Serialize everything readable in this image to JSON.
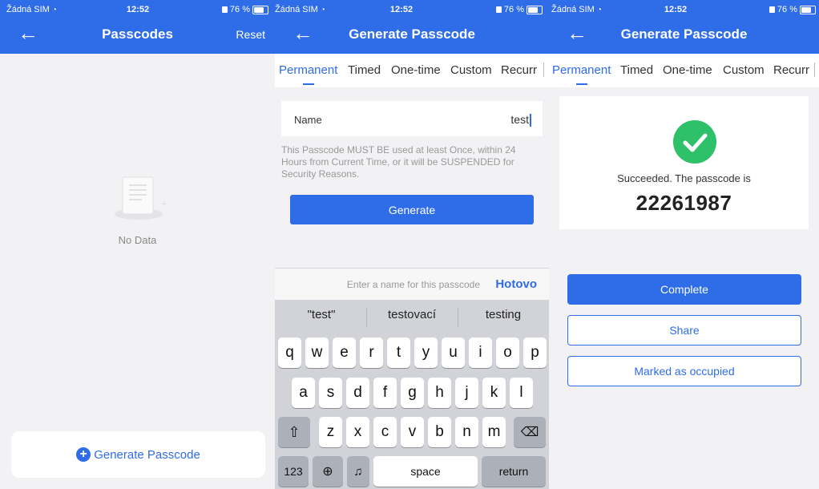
{
  "status": {
    "carrier": "Žádná SIM",
    "time": "12:52",
    "battery": "76 %"
  },
  "screen_list": {
    "title": "Passcodes",
    "reset_label": "Reset",
    "empty_text": "No Data",
    "generate_label": "Generate Passcode"
  },
  "screen_generate": {
    "title": "Generate Passcode",
    "tabs": [
      "Permanent",
      "Timed",
      "One-time",
      "Custom",
      "Recurr"
    ],
    "name_label": "Name",
    "name_value": "test",
    "note": "This Passcode MUST BE used at least Once, within 24 Hours from Current Time, or it will be SUSPENDED for Security Reasons.",
    "generate_label": "Generate",
    "accessory_placeholder": "Enter a name for this passcode",
    "done_label": "Hotovo",
    "suggestions": [
      "\"test\"",
      "testovací",
      "testing"
    ],
    "keys_row1": [
      "q",
      "w",
      "e",
      "r",
      "t",
      "y",
      "u",
      "i",
      "o",
      "p"
    ],
    "keys_row2": [
      "a",
      "s",
      "d",
      "f",
      "g",
      "h",
      "j",
      "k",
      "l"
    ],
    "keys_row3": [
      "z",
      "x",
      "c",
      "v",
      "b",
      "n",
      "m"
    ],
    "key_123": "123",
    "key_space": "space",
    "key_return": "return"
  },
  "screen_success": {
    "title": "Generate Passcode",
    "tabs": [
      "Permanent",
      "Timed",
      "One-time",
      "Custom",
      "Recurr"
    ],
    "success_text": "Succeeded. The passcode is",
    "passcode": "22261987",
    "complete_label": "Complete",
    "share_label": "Share",
    "occupied_label": "Marked as occupied"
  },
  "colors": {
    "accent": "#2f6ce8",
    "success": "#2ec16a",
    "background": "#f2f2f5"
  }
}
